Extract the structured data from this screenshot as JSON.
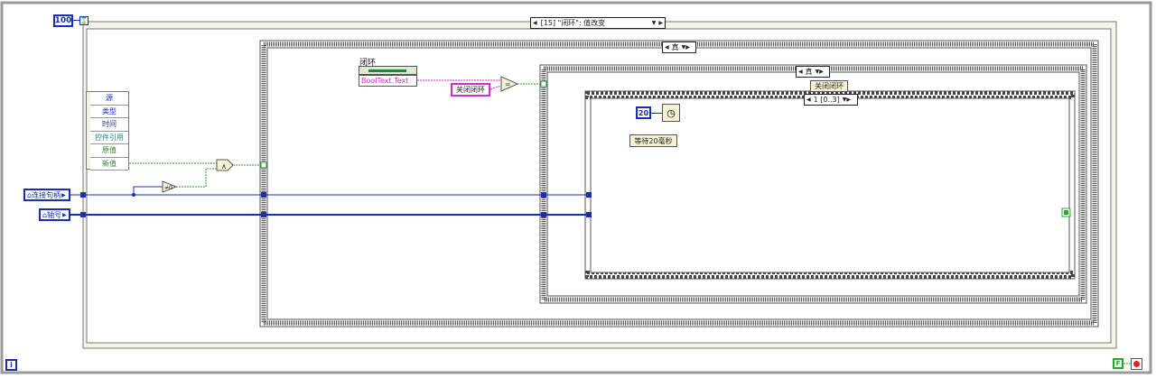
{
  "outer_while_loop": {
    "timeout_constant": "100",
    "event_selector": "[15] \"闭环\": 值改变"
  },
  "event_data_node": {
    "items": [
      "源",
      "类型",
      "时间",
      "控件引用",
      "原值",
      "新值"
    ],
    "colors": [
      "#1a2fb0",
      "#1a2fb0",
      "#1a2fb0",
      "#1a8a8a",
      "#2a8a2a",
      "#2a8a2a"
    ]
  },
  "inputs": {
    "connection_handle": "连接句柄",
    "number": "轴号"
  },
  "case1": {
    "selector": "真"
  },
  "boolean_control": {
    "label": "闭环",
    "property": "BoolText.Text"
  },
  "string_constant": "关闭闭环",
  "case2": {
    "selector": "真",
    "label": "关闭闭环"
  },
  "sequence": {
    "selector": "1 [0..3]"
  },
  "wait": {
    "constant": "20",
    "label": "等待20毫秒"
  },
  "loop_stop": {
    "value": "F"
  },
  "iteration_terminal": "i",
  "colors": {
    "integer_blue": "#1a2fb0",
    "boolean_green": "#2aa62a",
    "string_pink": "#d42ad4",
    "frame_gray": "#8c8c8c"
  }
}
